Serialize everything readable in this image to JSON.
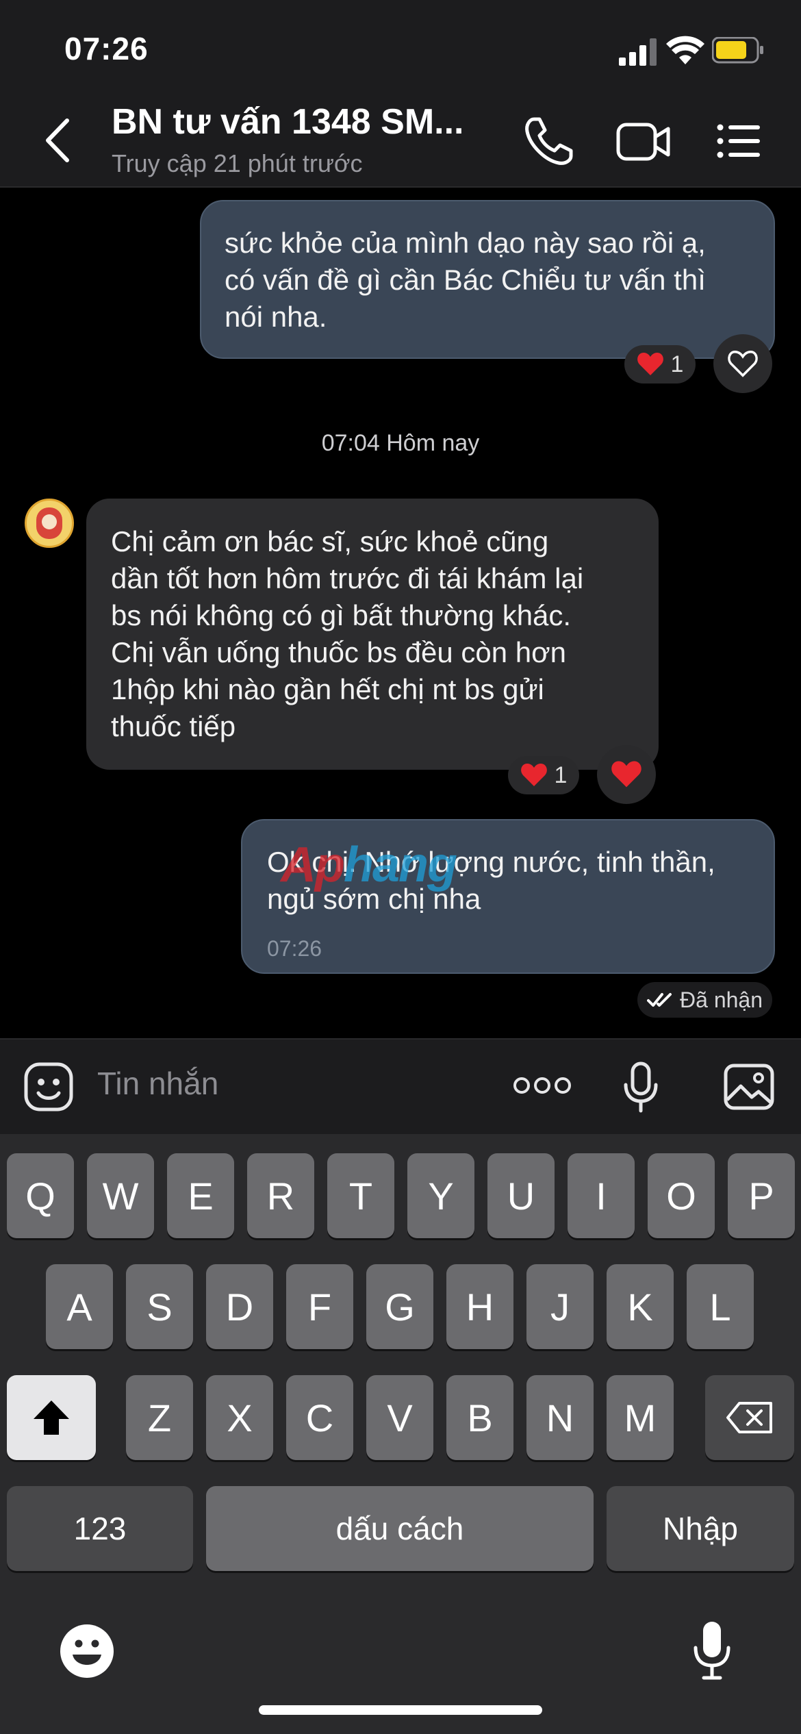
{
  "status_bar": {
    "time": "07:26"
  },
  "header": {
    "title": "BN tư vấn 1348 SM...",
    "subtitle": "Truy cập 21 phút trước"
  },
  "messages": [
    {
      "direction": "outgoing",
      "text": "sức khỏe của mình dạo này sao rồi ạ,\ncó vấn đề gì cần Bác Chiểu tư vấn thì\nnói nha.",
      "reaction_count": "1"
    },
    {
      "direction": "incoming",
      "text": "Chị cảm ơn bác sĩ, sức khoẻ cũng\ndần tốt hơn hôm trước đi tái khám lại\nbs nói không có gì bất thường khác.\nChị vẫn uống thuốc bs đều còn hơn\n1hộp khi nào gần hết chị nt bs gửi\nthuốc  tiếp",
      "reaction_count": "1"
    },
    {
      "direction": "outgoing",
      "text": "Ok chị. Nhớ lượng nước, tinh thần,\nngủ sớm chị nha",
      "time": "07:26"
    }
  ],
  "date_separator": "07:04 Hôm nay",
  "read_receipt": "Đã nhận",
  "compose": {
    "placeholder": "Tin nhắn"
  },
  "keyboard": {
    "row1": [
      "Q",
      "W",
      "E",
      "R",
      "T",
      "Y",
      "U",
      "I",
      "O",
      "P"
    ],
    "row2": [
      "A",
      "S",
      "D",
      "F",
      "G",
      "H",
      "J",
      "K",
      "L"
    ],
    "row3": [
      "Z",
      "X",
      "C",
      "V",
      "B",
      "N",
      "M"
    ],
    "numbers_label": "123",
    "space_label": "dấu cách",
    "return_label": "Nhập"
  },
  "watermark": {
    "part1": "Ap",
    "part2": "hang"
  },
  "colors": {
    "header_bg": "#1c1c1e",
    "outgoing_bubble": "#3a4656",
    "incoming_bubble": "#2c2c2e",
    "heart": "#e8262e",
    "battery": "#f5d31a"
  }
}
